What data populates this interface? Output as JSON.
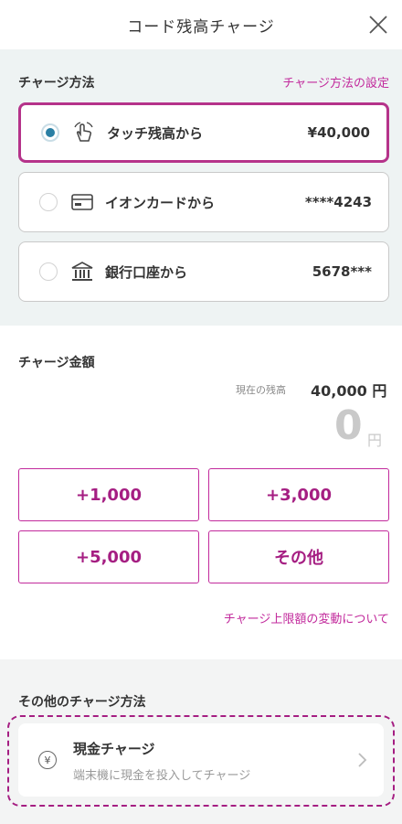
{
  "header": {
    "title": "コード残高チャージ"
  },
  "method": {
    "heading": "チャージ方法",
    "settings_link": "チャージ方法の設定",
    "options": [
      {
        "label": "タッチ残高から",
        "value": "¥40,000",
        "icon": "touch-hand-icon",
        "selected": true
      },
      {
        "label": "イオンカードから",
        "value": "****4243",
        "icon": "card-icon",
        "selected": false
      },
      {
        "label": "銀行口座から",
        "value": "5678***",
        "icon": "bank-icon",
        "selected": false
      }
    ]
  },
  "amount": {
    "heading": "チャージ金額",
    "balance_label": "現在の残高",
    "balance_value": "40,000 円",
    "amount": "0",
    "unit": "円",
    "buttons": [
      "+1,000",
      "+3,000",
      "+5,000",
      "その他"
    ],
    "limit_link": "チャージ上限額の変動について"
  },
  "other": {
    "heading": "その他のチャージ方法",
    "cash_title": "現金チャージ",
    "cash_subtitle": "端末機に現金を投入してチャージ"
  },
  "colors": {
    "accent": "#c22a9c",
    "accent_dark": "#a51e82",
    "radio": "#2a7fa4"
  }
}
